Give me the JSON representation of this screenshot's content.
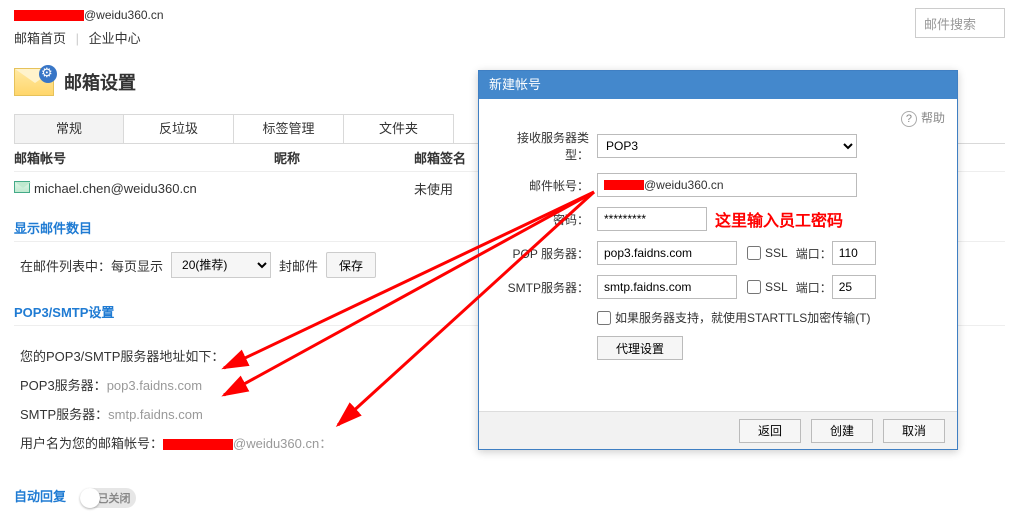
{
  "header": {
    "email_suffix": "@weidu360.cn",
    "nav_home": "邮箱首页",
    "nav_enterprise": "企业中心",
    "search_placeholder": "邮件搜索"
  },
  "mailbox": {
    "settings_title": "邮箱设置",
    "tabs": [
      "常规",
      "反垃圾",
      "标签管理",
      "文件夹"
    ],
    "col_account": "邮箱帐号",
    "col_nick": "昵称",
    "col_sig": "邮箱签名",
    "row_email": "michael.chen@weidu360.cn",
    "row_sig": "未使用"
  },
  "display_count": {
    "title": "显示邮件数目",
    "pre": "在邮件列表中：每页显示",
    "dropdown": "20(推荐)",
    "suffix": "封邮件",
    "save": "保存"
  },
  "smtp": {
    "title": "POP3/SMTP设置",
    "line1": "您的POP3/SMTP服务器地址如下：",
    "pop_label": "POP3服务器：",
    "pop_val": "pop3.faidns.com",
    "smtp_label": "SMTP服务器：",
    "smtp_val": "smtp.faidns.com",
    "user_label": "用户名为您的邮箱帐号：",
    "user_suffix": "@weidu360.cn："
  },
  "autoreply": {
    "title": "自动回复",
    "toggle": "已关闭"
  },
  "dialog": {
    "title": "新建帐号",
    "help": "帮助",
    "type_label": "接收服务器类型：",
    "type_value": "POP3",
    "acct_label": "邮件帐号：",
    "acct_suffix": "@weidu360.cn",
    "pwd_label": "密码：",
    "pwd_value": "*********",
    "pwd_note": "这里输入员工密码",
    "pop_label": "POP 服务器：",
    "pop_value": "pop3.faidns.com",
    "smtp_label": "SMTP服务器：",
    "smtp_value": "smtp.faidns.com",
    "ssl": "SSL",
    "port": "端口：",
    "pop_port": "110",
    "smtp_port": "25",
    "starttls": "如果服务器支持，就使用STARTTLS加密传输(T)",
    "proxy_btn": "代理设置",
    "btn_back": "返回",
    "btn_create": "创建",
    "btn_cancel": "取消"
  }
}
